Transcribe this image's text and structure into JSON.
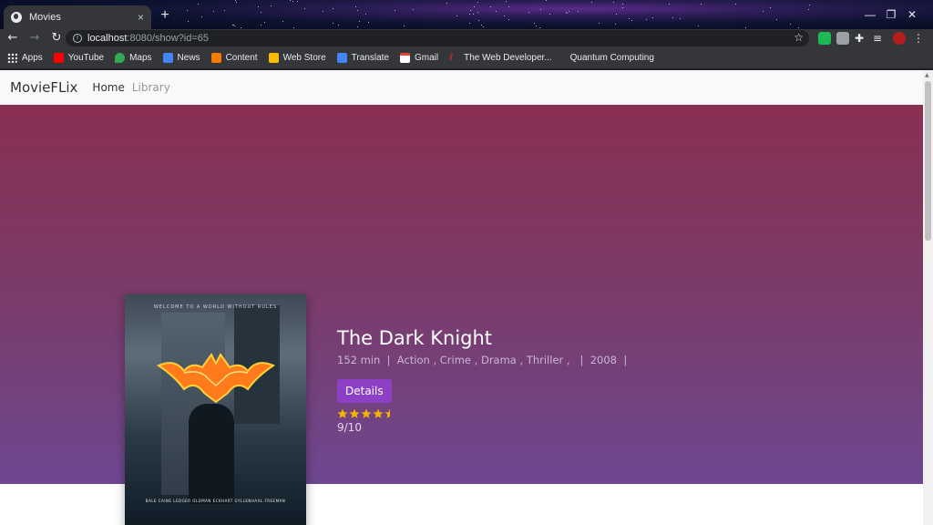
{
  "browser": {
    "tab_title": "Movies",
    "tab_close": "×",
    "new_tab": "+",
    "url_host": "localhost",
    "url_rest": ":8080/show?id=65",
    "window_controls": {
      "minimize": "—",
      "restore": "❐",
      "close": "✕"
    },
    "bookmarks": [
      {
        "label": "Apps",
        "color": "#e8eaed"
      },
      {
        "label": "YouTube",
        "color": "#ff0000"
      },
      {
        "label": "Maps",
        "color": "#34a853"
      },
      {
        "label": "News",
        "color": "#4285f4"
      },
      {
        "label": "Content",
        "color": "#f57c00"
      },
      {
        "label": "Web Store",
        "color": "#fbbc04"
      },
      {
        "label": "Translate",
        "color": "#4285f4"
      },
      {
        "label": "Gmail",
        "color": "#ea4335"
      },
      {
        "label": "The Web Developer...",
        "color": "#d32f2f"
      },
      {
        "label": "Quantum Computing",
        "color": "#35363a"
      }
    ]
  },
  "navbar": {
    "brand": "MovieFLix",
    "links": [
      {
        "label": "Home",
        "active": true
      },
      {
        "label": "Library",
        "active": false
      }
    ]
  },
  "movie": {
    "title": "The Dark Knight",
    "runtime": "152 min",
    "genres": "Action , Crime , Drama , Thriller ,",
    "year": "2008",
    "details_label": "Details",
    "rating_stars": 4.5,
    "rating_text": "9/10",
    "poster": {
      "tagline": "WELCOME TO A WORLD WITHOUT RULES",
      "cast": "BALE  CAINE  LEDGER  OLDMAN  ECKHART  GYLLENHAAL  FREEMAN"
    }
  },
  "colors": {
    "hero_top": "#8a2f53",
    "hero_bottom": "#6e4790",
    "button": "#8d3fc5",
    "star": "#f5b301"
  }
}
